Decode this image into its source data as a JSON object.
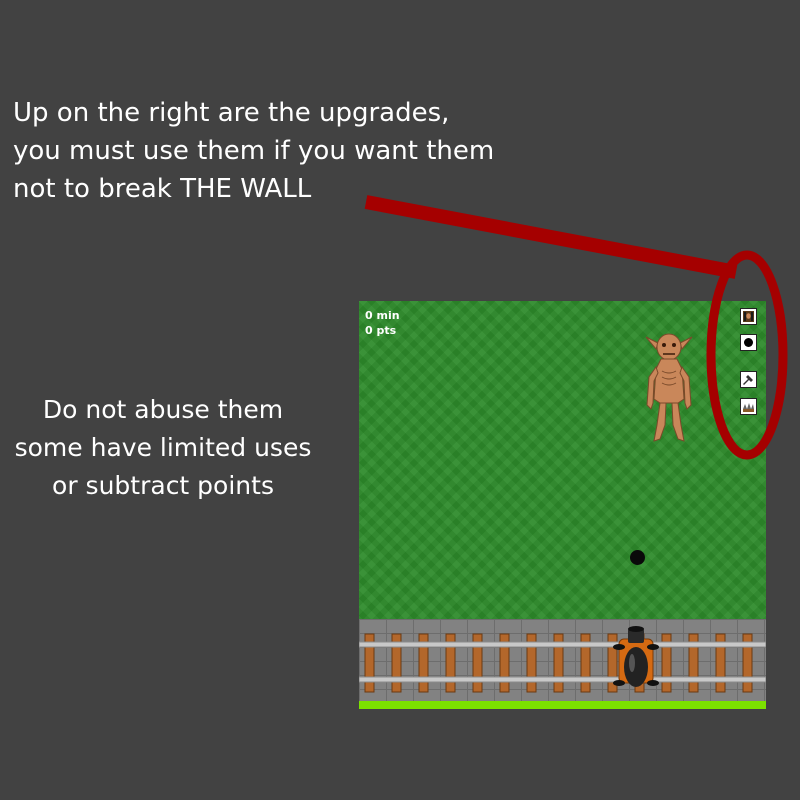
{
  "instructions": {
    "top_lines": [
      "Up on the right are the upgrades,",
      "you must use them if you want them",
      "not to break THE WALL"
    ],
    "left_lines": [
      "Do not abuse them",
      "some have limited uses",
      "or subtract points"
    ]
  },
  "game": {
    "hud": {
      "time": "0 min",
      "points": "0 pts"
    },
    "upgrades": [
      {
        "icon": "goblin-trap-icon"
      },
      {
        "icon": "bomb-icon"
      },
      {
        "icon": "hammer-icon"
      },
      {
        "icon": "spikes-icon"
      }
    ],
    "enemy": "goblin",
    "projectile": "ball"
  },
  "colors": {
    "background": "#424242",
    "grass": "#2d8a2a",
    "highlight": "#a50000",
    "rail": "#b0b0b0",
    "sleeper": "#b3672b",
    "boundary": "#7ce200"
  }
}
